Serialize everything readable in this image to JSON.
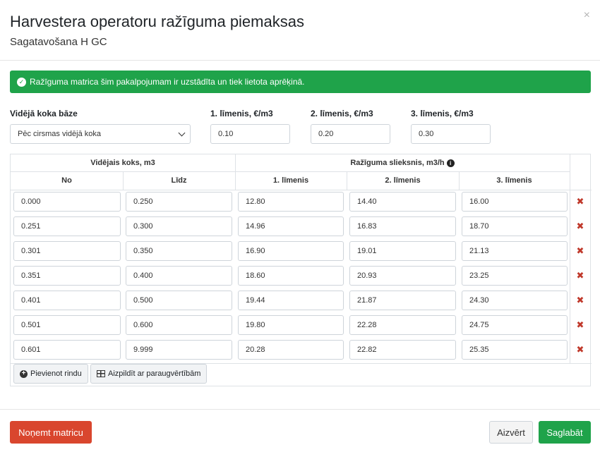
{
  "header": {
    "title": "Harvestera operatoru ražīguma piemaksas",
    "subtitle": "Sagatavošana H GC",
    "close_symbol": "×"
  },
  "alert": {
    "message": "Ražīguma matrica šim pakalpojumam ir uzstādīta un tiek lietota aprēķinā.",
    "color": "#1fa34a",
    "icon": "check-circle-icon"
  },
  "form": {
    "base_label": "Vidējā koka bāze",
    "base_value": "Pēc cirsmas vidējā koka",
    "levels": [
      {
        "label": "1. līmenis, €/m3",
        "value": "0.10"
      },
      {
        "label": "2. līmenis, €/m3",
        "value": "0.20"
      },
      {
        "label": "3. līmenis, €/m3",
        "value": "0.30"
      }
    ]
  },
  "matrix": {
    "group_avg": "Vidējais koks, m3",
    "group_threshold": "Ražīguma slieksnis, m3/h",
    "col_from": "No",
    "col_to": "Līdz",
    "col_l1": "1. līmenis",
    "col_l2": "2. līmenis",
    "col_l3": "3. līmenis",
    "delete_symbol": "✖",
    "rows": [
      {
        "from": "0.000",
        "to": "0.250",
        "l1": "12.80",
        "l2": "14.40",
        "l3": "16.00"
      },
      {
        "from": "0.251",
        "to": "0.300",
        "l1": "14.96",
        "l2": "16.83",
        "l3": "18.70"
      },
      {
        "from": "0.301",
        "to": "0.350",
        "l1": "16.90",
        "l2": "19.01",
        "l3": "21.13"
      },
      {
        "from": "0.351",
        "to": "0.400",
        "l1": "18.60",
        "l2": "20.93",
        "l3": "23.25"
      },
      {
        "from": "0.401",
        "to": "0.500",
        "l1": "19.44",
        "l2": "21.87",
        "l3": "24.30"
      },
      {
        "from": "0.501",
        "to": "0.600",
        "l1": "19.80",
        "l2": "22.28",
        "l3": "24.75"
      },
      {
        "from": "0.601",
        "to": "9.999",
        "l1": "20.28",
        "l2": "22.82",
        "l3": "25.35"
      }
    ],
    "add_row_label": "Pievienot rindu",
    "fill_sample_label": "Aizpildīt ar paraugvērtībām"
  },
  "footer": {
    "remove_label": "Noņemt matricu",
    "cancel_label": "Aizvērt",
    "save_label": "Saglabāt",
    "danger_color": "#d9462e",
    "success_color": "#1fa34a"
  }
}
